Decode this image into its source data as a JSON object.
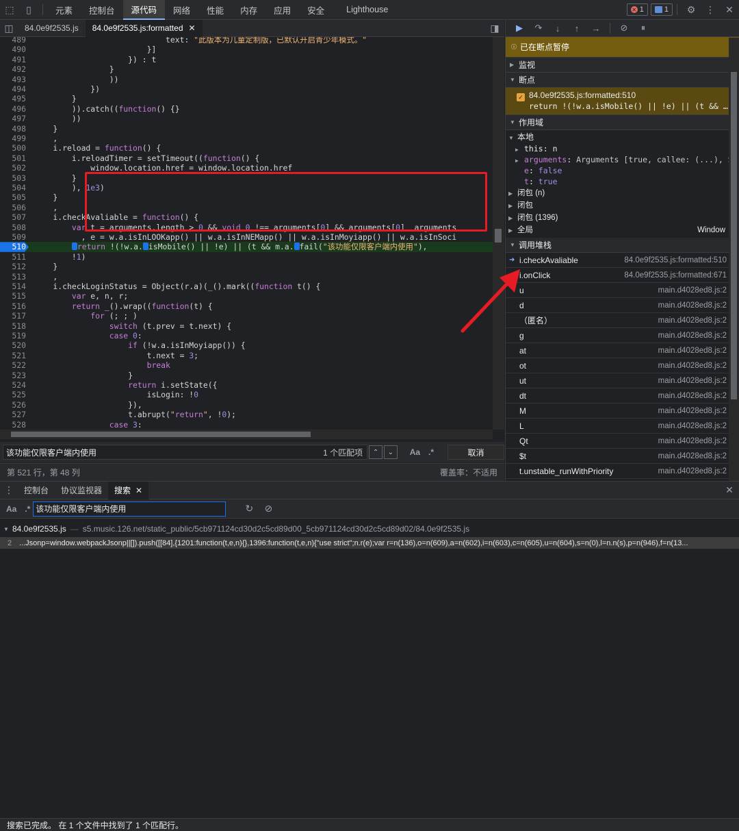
{
  "toolbar": {
    "tabs": [
      "元素",
      "控制台",
      "源代码",
      "网络",
      "性能",
      "内存",
      "应用",
      "安全",
      "Lighthouse"
    ],
    "active_tab": "源代码",
    "error_count": "1",
    "message_count": "1"
  },
  "file_tabs": [
    {
      "label": "84.0e9f2535.js"
    },
    {
      "label": "84.0e9f2535.js:formatted"
    }
  ],
  "editor": {
    "lines": [
      {
        "n": "489",
        "code": "                            text: \"此版本为儿童定制版，已默认开启青少年模式。\""
      },
      {
        "n": "490",
        "code": "                        }]"
      },
      {
        "n": "491",
        "code": "                    }) : t"
      },
      {
        "n": "492",
        "code": "                }"
      },
      {
        "n": "493",
        "code": "                ))"
      },
      {
        "n": "494",
        "code": "            })"
      },
      {
        "n": "495",
        "code": "        }"
      },
      {
        "n": "496",
        "code": "        )).catch((function() {}"
      },
      {
        "n": "497",
        "code": "        ))"
      },
      {
        "n": "498",
        "code": "    }"
      },
      {
        "n": "499",
        "code": "    ,"
      },
      {
        "n": "500",
        "code": "    i.reload = function() {"
      },
      {
        "n": "501",
        "code": "        i.reloadTimer = setTimeout((function() {"
      },
      {
        "n": "502",
        "code": "            window.location.href = window.location.href"
      },
      {
        "n": "503",
        "code": "        }"
      },
      {
        "n": "504",
        "code": "        ), 1e3)"
      },
      {
        "n": "505",
        "code": "    }"
      },
      {
        "n": "506",
        "code": "    ,"
      },
      {
        "n": "507",
        "code": "    i.checkAvaliable = function() {"
      },
      {
        "n": "508",
        "code": "        var t = arguments.length > 0 && void 0 !== arguments[0] && arguments[0]  arguments"
      },
      {
        "n": "509",
        "code": "          , e = w.a.isInLOOKapp() || w.a.isInNEMapp() || w.a.isInMoyiapp() || w.a.isInSoci"
      },
      {
        "n": "510",
        "code": "        ▮return !(!w.a.▮isMobile() || !e) || (t && m.a.▮fail(\"该功能仅限客户端内使用\"),"
      },
      {
        "n": "511",
        "code": "        !1)"
      },
      {
        "n": "512",
        "code": "    }"
      },
      {
        "n": "513",
        "code": "    ,"
      },
      {
        "n": "514",
        "code": "    i.checkLoginStatus = Object(r.a)(_().mark((function t() {"
      },
      {
        "n": "515",
        "code": "        var e, n, r;"
      },
      {
        "n": "516",
        "code": "        return _().wrap((function(t) {"
      },
      {
        "n": "517",
        "code": "            for (; ; )"
      },
      {
        "n": "518",
        "code": "                switch (t.prev = t.next) {"
      },
      {
        "n": "519",
        "code": "                case 0:"
      },
      {
        "n": "520",
        "code": "                    if (!w.a.isInMoyiapp()) {"
      },
      {
        "n": "521",
        "code": "                        t.next = 3;"
      },
      {
        "n": "522",
        "code": "                        break"
      },
      {
        "n": "523",
        "code": "                    }"
      },
      {
        "n": "524",
        "code": "                    return i.setState({"
      },
      {
        "n": "525",
        "code": "                        isLogin: !0"
      },
      {
        "n": "526",
        "code": "                    }),"
      },
      {
        "n": "527",
        "code": "                    t.abrupt(\"return\", !0);"
      },
      {
        "n": "528",
        "code": "                case 3:"
      }
    ],
    "breakpoint_line": "510"
  },
  "find": {
    "query": "该功能仅限客户端内使用",
    "count": "1 个匹配项",
    "case_label": "Aa",
    "regex_label": ".*",
    "cancel_label": "取消"
  },
  "status": {
    "position": "第 521 行，第 48 列",
    "coverage": "覆盖率：不适用"
  },
  "debugger": {
    "paused": "已在断点暂停",
    "watch": "监视",
    "breakpoints": "断点",
    "bp_file": "84.0e9f2535.js:formatted:510",
    "bp_code": "return !(!w.a.isMobile() || !e) || (t && …",
    "scope": "作用域",
    "local": "本地",
    "scope_rows": [
      {
        "key": "this",
        "val": "n"
      },
      {
        "key": "arguments",
        "val": "Arguments [true, callee: (...), Sym"
      },
      {
        "key": "e",
        "val": "false"
      },
      {
        "key": "t",
        "val": "true"
      }
    ],
    "closures": [
      "闭包 (n)",
      "闭包",
      "闭包 (1396)"
    ],
    "global": "全局",
    "global_val": "Window",
    "callstack": "调用堆栈",
    "frames": [
      {
        "name": "i.checkAvaliable",
        "loc": "84.0e9f2535.js:formatted:510"
      },
      {
        "name": "i.onClick",
        "loc": "84.0e9f2535.js:formatted:671"
      },
      {
        "name": "u",
        "loc": "main.d4028ed8.js:2"
      },
      {
        "name": "d",
        "loc": "main.d4028ed8.js:2"
      },
      {
        "name": "（匿名）",
        "loc": "main.d4028ed8.js:2"
      },
      {
        "name": "g",
        "loc": "main.d4028ed8.js:2"
      },
      {
        "name": "at",
        "loc": "main.d4028ed8.js:2"
      },
      {
        "name": "ot",
        "loc": "main.d4028ed8.js:2"
      },
      {
        "name": "ut",
        "loc": "main.d4028ed8.js:2"
      },
      {
        "name": "dt",
        "loc": "main.d4028ed8.js:2"
      },
      {
        "name": "M",
        "loc": "main.d4028ed8.js:2"
      },
      {
        "name": "L",
        "loc": "main.d4028ed8.js:2"
      },
      {
        "name": "Qt",
        "loc": "main.d4028ed8.js:2"
      },
      {
        "name": "$t",
        "loc": "main.d4028ed8.js:2"
      },
      {
        "name": "t.unstable_runWithPriority",
        "loc": "main.d4028ed8.js:2"
      }
    ]
  },
  "drawer": {
    "tabs": [
      "控制台",
      "协议监视器",
      "搜索"
    ],
    "active": "搜索",
    "search_query": "该功能仅限客户端内使用",
    "result_file": "84.0e9f2535.js",
    "result_path": "s5.music.126.net/static_public/5cb971124cd30d2c5cd89d00_5cb971124cd30d2c5cd89d02/84.0e9f2535.js",
    "result_line_no": "2",
    "result_text": "...Jsonp=window.webpackJsonp||[]).push([[84],{1201:function(t,e,n){},1396:function(t,e,n){\"use strict\";n.r(e);var r=n(136),o=n(609),a=n(602),i=n(603),c=n(605),u=n(604),s=n(0),l=n.n(s),p=n(946),f=n(13...",
    "status": "搜索已完成。 在 1 个文件中找到了 1 个匹配行。"
  }
}
